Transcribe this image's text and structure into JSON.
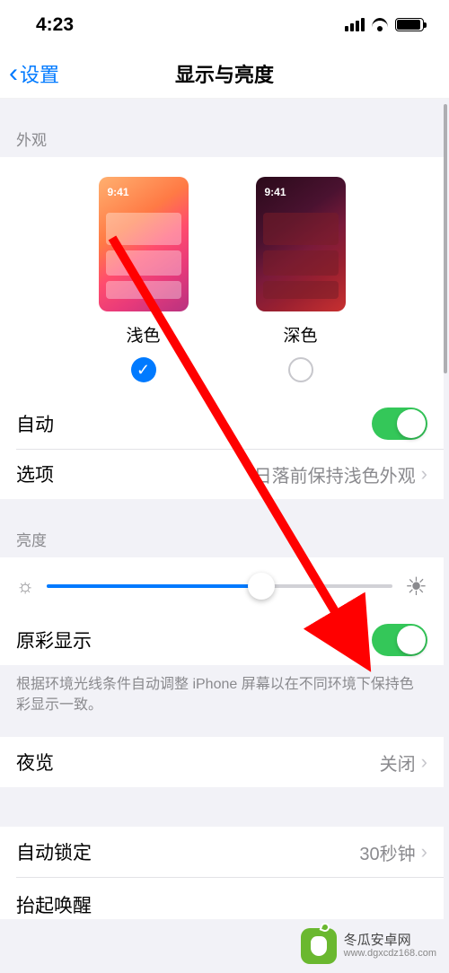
{
  "status": {
    "time": "4:23"
  },
  "nav": {
    "back_label": "设置",
    "title": "显示与亮度"
  },
  "appearance": {
    "header": "外观",
    "mock_time": "9:41",
    "light_label": "浅色",
    "dark_label": "深色",
    "light_selected": true,
    "dark_selected": false
  },
  "auto": {
    "label": "自动",
    "enabled": true
  },
  "options": {
    "label": "选项",
    "value": "日落前保持浅色外观"
  },
  "brightness": {
    "header": "亮度",
    "value_percent": 62
  },
  "true_tone": {
    "label": "原彩显示",
    "enabled": true,
    "footer": "根据环境光线条件自动调整 iPhone 屏幕以在不同环境下保持色彩显示一致。"
  },
  "night_shift": {
    "label": "夜览",
    "value": "关闭"
  },
  "auto_lock": {
    "label": "自动锁定",
    "value": "30秒钟"
  },
  "raise_to_wake": {
    "label": "抬起唤醒"
  },
  "watermark": {
    "line1": "冬瓜安卓网",
    "line2": "www.dgxcdz168.com"
  },
  "colors": {
    "accent": "#007aff",
    "toggle_on": "#34c759",
    "arrow": "#ff0000"
  }
}
